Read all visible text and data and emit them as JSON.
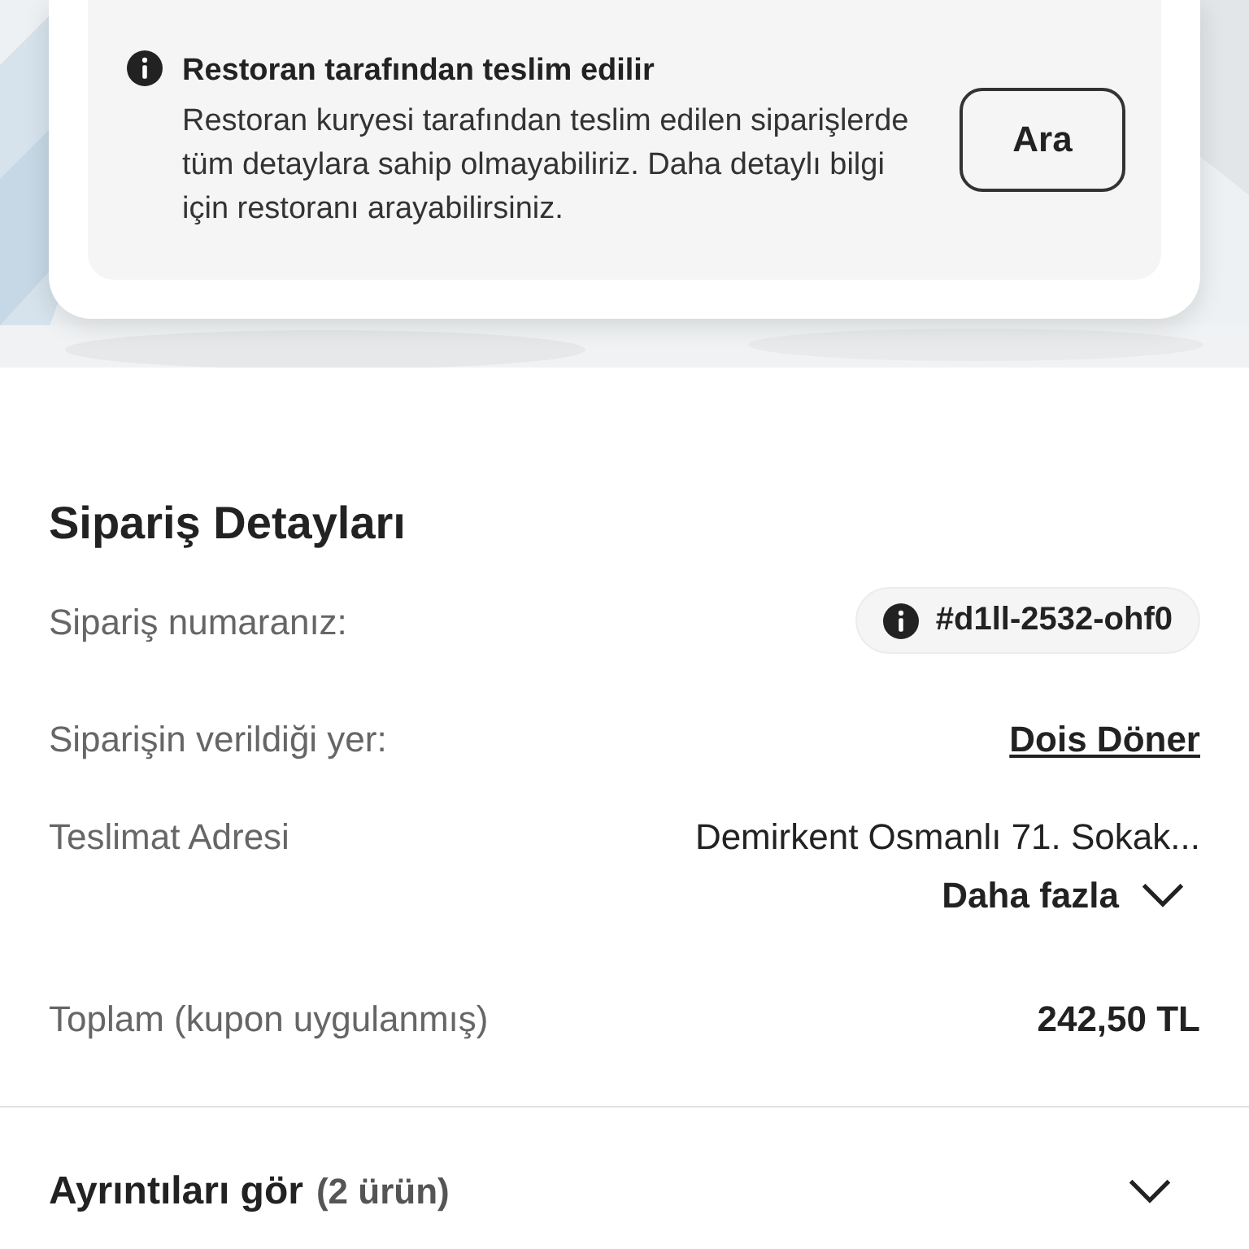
{
  "notice": {
    "title": "Restoran tarafından teslim edilir",
    "body": "Restoran kuryesi tarafından teslim edilen siparişlerde tüm detaylara sahip olmayabiliriz. Daha detaylı bilgi için restoranı arayabilirsiniz.",
    "button": "Ara"
  },
  "order_details": {
    "title": "Sipariş Detayları",
    "rows": [
      {
        "kind": "badge",
        "label": "Sipariş numaranız:",
        "value": "#d1ll-2532-ohf0"
      },
      {
        "kind": "link",
        "label": "Siparişin verildiği yer:",
        "value": "Dois Döner"
      },
      {
        "kind": "address",
        "label": "Teslimat Adresi",
        "value": "Demirkent Osmanlı 71. Sokak...",
        "more": "Daha fazla"
      },
      {
        "kind": "plain",
        "label": "Toplam (kupon uygulanmış)",
        "value": "242,50 TL"
      }
    ]
  },
  "details": {
    "label": "Ayrıntıları gör",
    "count": "(2 ürün)",
    "expanded": false
  }
}
